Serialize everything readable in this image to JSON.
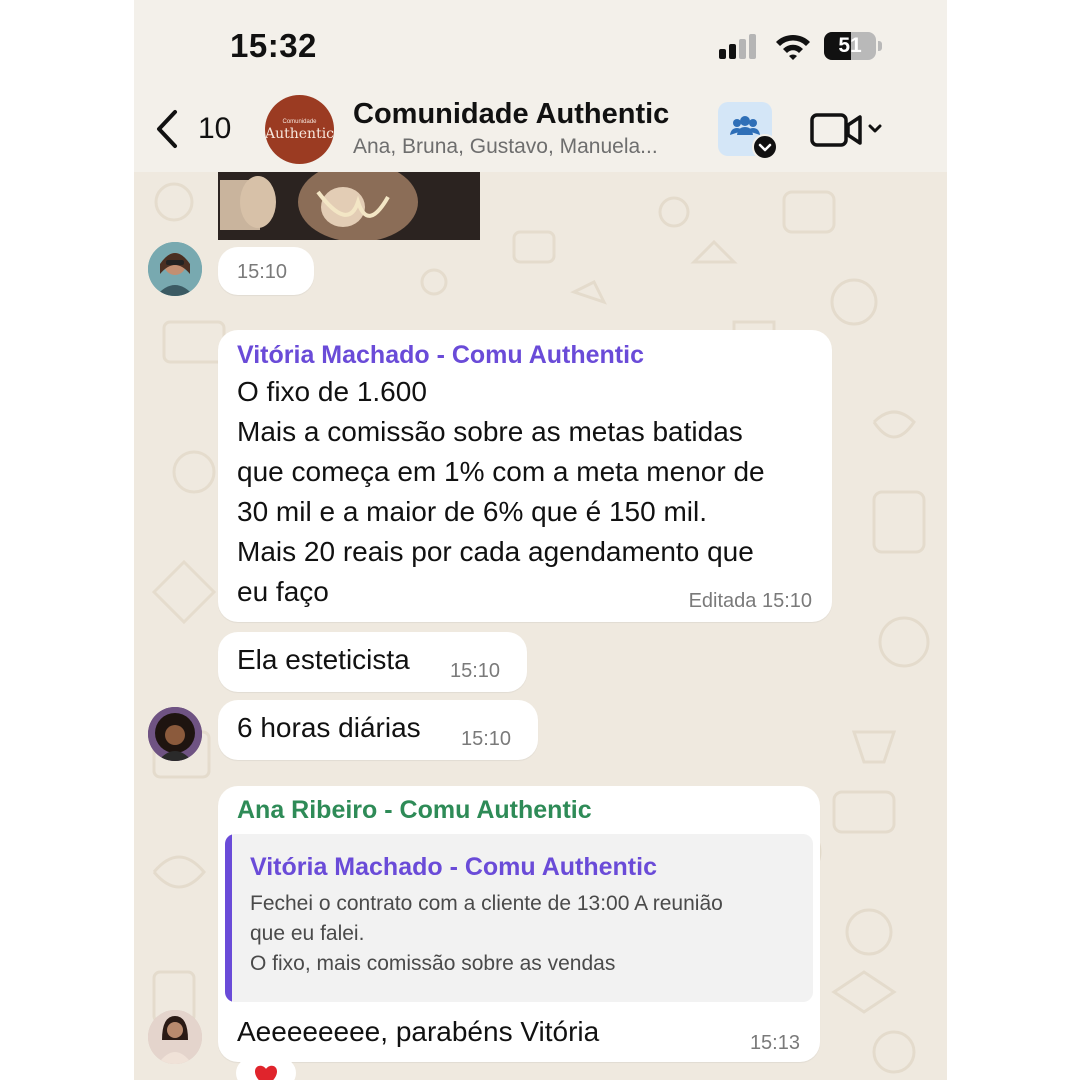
{
  "status_bar": {
    "time": "15:32",
    "battery": 51,
    "icons": [
      "cellular-signal-icon",
      "wifi-icon",
      "battery-icon"
    ]
  },
  "header": {
    "back_count": "10",
    "group_name": "Comunidade Authentic",
    "members": "Ana, Bruna, Gustavo, Manuela...",
    "avatar_small": "Comunidade",
    "avatar_large": "Authentic",
    "icons": [
      "chevron-left-icon",
      "community-members-icon",
      "video-camera-icon",
      "chevron-down-icon"
    ]
  },
  "colors": {
    "accent_purple": "#6a4bd8",
    "accent_green": "#2e8b57",
    "group_avatar": "#9b3b22",
    "chat_bg": "#efe9df",
    "bubble": "#ffffff",
    "reaction": "#e0242c"
  },
  "messages": [
    {
      "type": "image",
      "time": "15:10"
    },
    {
      "sender": "Vitória Machado - Comu Authentic",
      "lines": [
        "O fixo de 1.600",
        "Mais a comissão sobre as metas batidas",
        "que começa em 1% com a meta menor de",
        "30 mil e a maior de 6% que é 150 mil.",
        "Mais 20 reais por cada agendamento que",
        "eu faço"
      ],
      "time": "Editada 15:10"
    },
    {
      "text": "Ela esteticista",
      "time": "15:10"
    },
    {
      "text": "6 horas diárias",
      "time": "15:10"
    },
    {
      "sender": "Ana Ribeiro - Comu Authentic",
      "quote": {
        "sender": "Vitória Machado - Comu Authentic",
        "lines": [
          "Fechei o contrato com a cliente de 13:00 A reunião",
          "que eu falei.",
          "O fixo, mais comissão sobre as vendas"
        ]
      },
      "text": "Aeeeeeeee, parabéns Vitória",
      "time": "15:13",
      "reaction": "heart-reaction-icon"
    }
  ]
}
